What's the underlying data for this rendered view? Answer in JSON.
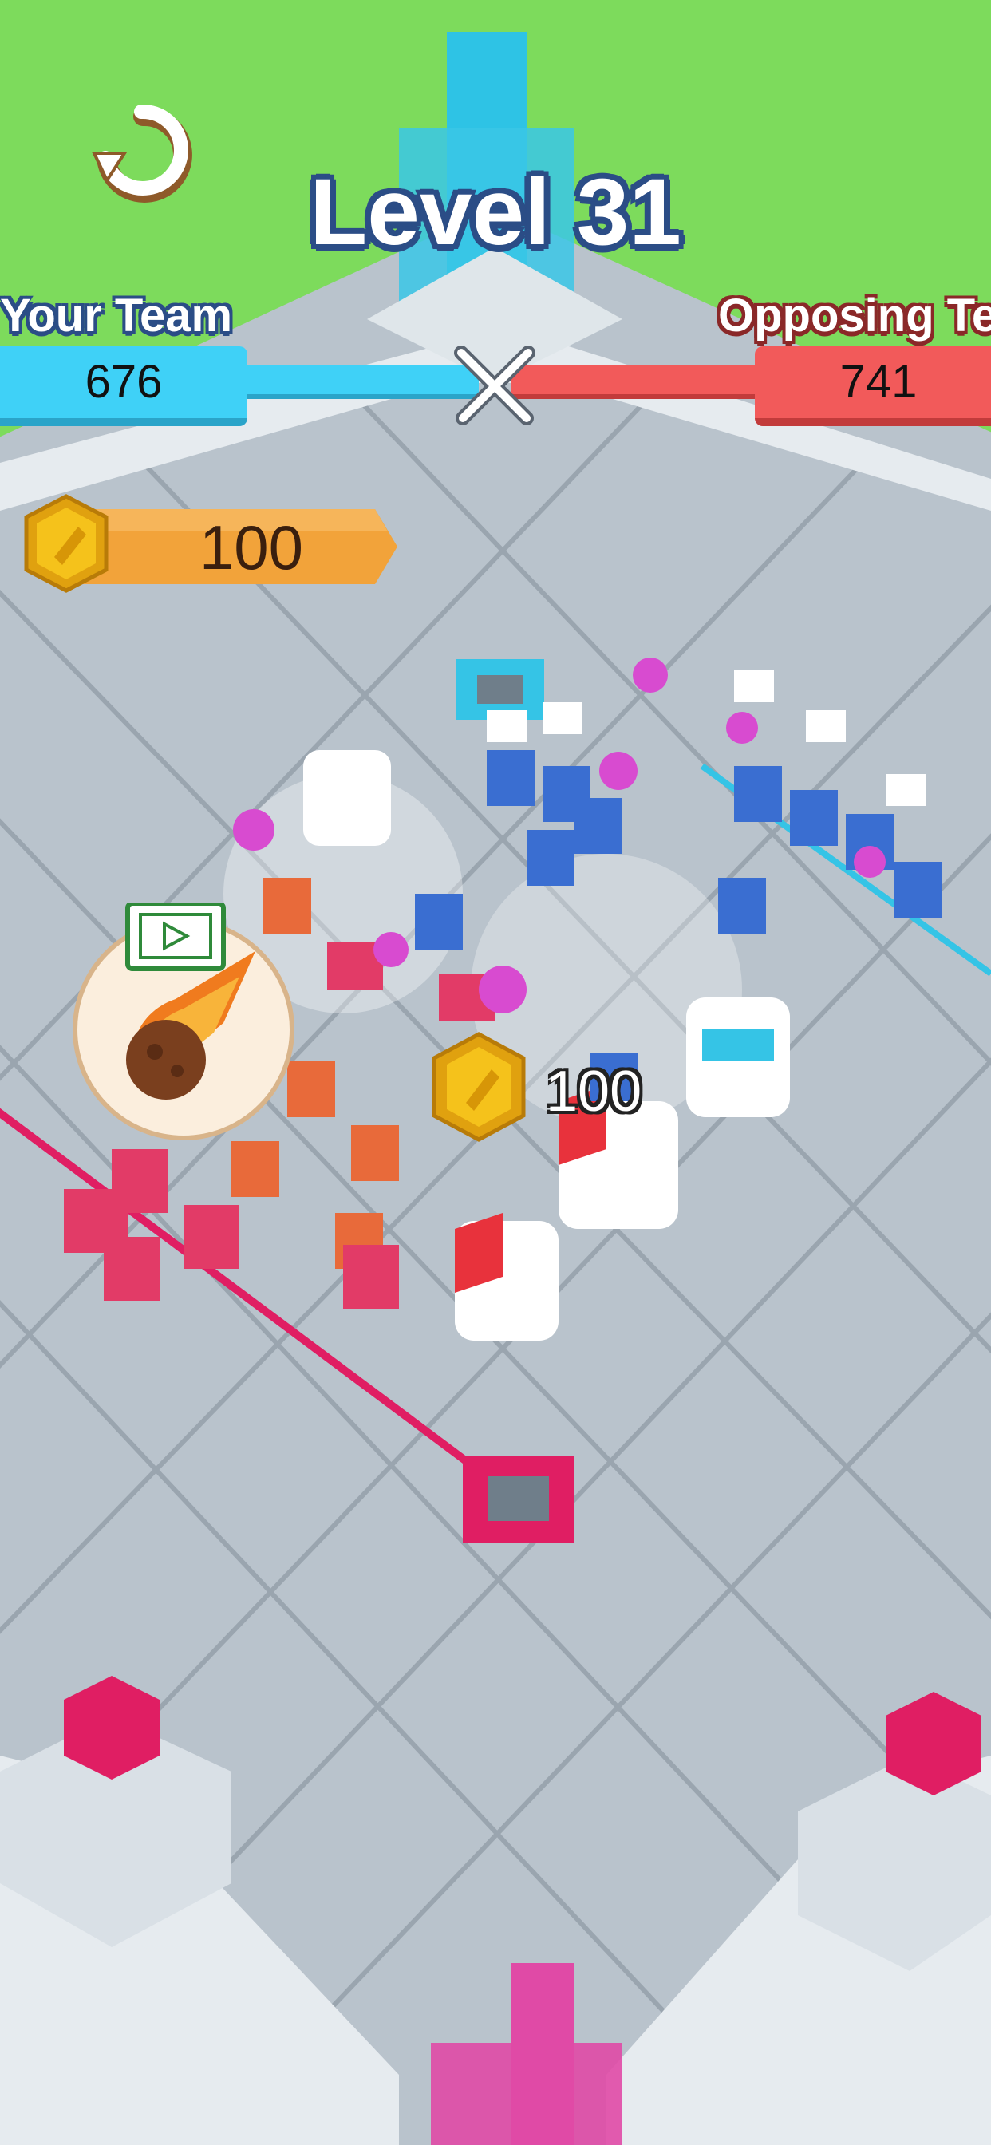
{
  "hud": {
    "level_title": "Level 31",
    "your_team_label": "Your Team",
    "opposing_team_label": "Opposing Te",
    "your_team_score": "676",
    "opposing_team_score": "741",
    "restart_icon": "restart-icon",
    "versus_icon": "crossed-swords-icon"
  },
  "coins": {
    "balance": "100",
    "icon": "gold-coin-icon"
  },
  "powerup": {
    "icon": "meteor-icon",
    "ad_icon": "video-ad-icon"
  },
  "floating_reward": {
    "icon": "gold-coin-icon",
    "amount": "100"
  },
  "colors": {
    "your_team": "#3fd1f7",
    "opposing_team": "#f25a5a",
    "grass": "#7ddb5c",
    "floor": "#b9c3cc",
    "red_tower": "#e01e63",
    "blue_tower": "#35c4e6",
    "coin": "#f5c21b"
  }
}
